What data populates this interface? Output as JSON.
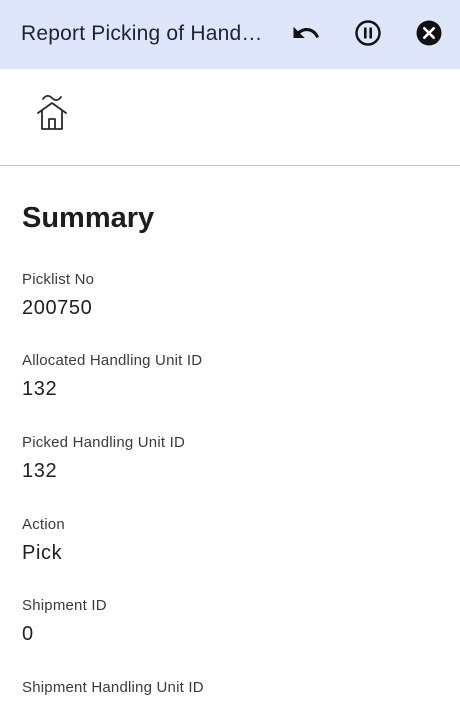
{
  "header": {
    "title": "Report Picking of Hand…",
    "bg_color": "#dfe6fb",
    "undo_icon": "undo-icon",
    "pause_icon": "pause-circle-icon",
    "close_icon": "close-circle-icon"
  },
  "home": {
    "icon": "home-icon"
  },
  "summary": {
    "title": "Summary",
    "fields": [
      {
        "label": "Picklist No",
        "value": "200750"
      },
      {
        "label": "Allocated Handling Unit ID",
        "value": "132"
      },
      {
        "label": "Picked Handling Unit ID",
        "value": "132"
      },
      {
        "label": "Action",
        "value": "Pick"
      },
      {
        "label": "Shipment ID",
        "value": "0"
      },
      {
        "label": "Shipment Handling Unit ID",
        "value": ""
      }
    ]
  }
}
